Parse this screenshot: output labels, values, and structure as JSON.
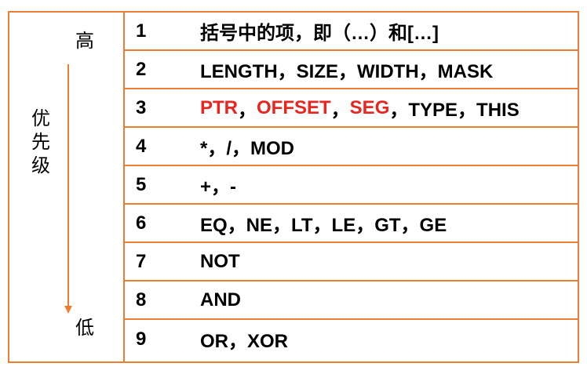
{
  "left": {
    "high": "高",
    "low": "低",
    "priority": "优先级"
  },
  "colors": {
    "border": "#ED7D31",
    "highlight": "#E8251F",
    "text": "#000000"
  },
  "rows": [
    {
      "num": "1",
      "text": "括号中的项，即（…）和[…]"
    },
    {
      "num": "2",
      "text": "LENGTH，SIZE，WIDTH，MASK"
    },
    {
      "num": "3",
      "parts": [
        "PTR",
        "，",
        "OFFSET",
        "，",
        "SEG",
        "，TYPE，THIS"
      ]
    },
    {
      "num": "4",
      "text": "*，/，MOD"
    },
    {
      "num": "5",
      "text": "+，-"
    },
    {
      "num": "6",
      "text": "EQ，NE，LT，LE，GT，GE"
    },
    {
      "num": "7",
      "text": "NOT"
    },
    {
      "num": "8",
      "text": "AND"
    },
    {
      "num": "9",
      "text": "OR，XOR"
    }
  ]
}
